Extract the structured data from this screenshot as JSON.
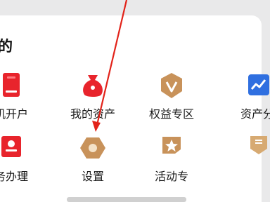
{
  "section": {
    "title": "的"
  },
  "grid": [
    {
      "label": "机开户",
      "icon": "account-card-icon"
    },
    {
      "label": "我的资产",
      "icon": "money-bag-icon"
    },
    {
      "label": "权益专区",
      "icon": "badge-v-icon"
    },
    {
      "label": "资产分",
      "icon": "chart-trend-icon"
    },
    {
      "label": "务办理",
      "icon": "stamp-icon"
    },
    {
      "label": "设置",
      "icon": "settings-hexagon-icon"
    },
    {
      "label": "活动专",
      "icon": "star-flag-icon"
    },
    {
      "label": "",
      "icon": "gold-badge-icon"
    }
  ],
  "colors": {
    "red": "#e8242c",
    "gold": "#c8925a",
    "blue": "#2f6fe0",
    "arrow": "#e2231a"
  }
}
